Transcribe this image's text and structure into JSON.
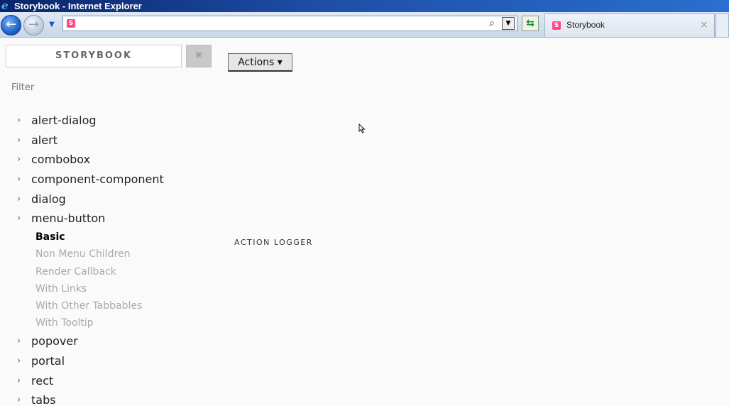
{
  "window": {
    "title": "Storybook - Internet Explorer"
  },
  "navbar": {
    "address_value": "",
    "favicon_letter": "S",
    "tab_label": "Storybook",
    "tab_close": "×"
  },
  "sidebar": {
    "brand": "STORYBOOK",
    "shortcut_icon": "⌘",
    "filter_placeholder": "Filter",
    "kinds": [
      {
        "label": "alert-dialog"
      },
      {
        "label": "alert"
      },
      {
        "label": "combobox"
      },
      {
        "label": "component-component"
      },
      {
        "label": "dialog"
      },
      {
        "label": "menu-button"
      }
    ],
    "stories": [
      {
        "label": "Basic",
        "active": true
      },
      {
        "label": "Non Menu Children",
        "active": false
      },
      {
        "label": "Render Callback",
        "active": false
      },
      {
        "label": "With Links",
        "active": false
      },
      {
        "label": "With Other Tabbables",
        "active": false
      },
      {
        "label": "With Tooltip",
        "active": false
      }
    ],
    "kinds_after": [
      {
        "label": "popover"
      },
      {
        "label": "portal"
      },
      {
        "label": "rect"
      },
      {
        "label": "tabs"
      }
    ]
  },
  "main": {
    "actions_label": "Actions ▾",
    "action_logger_label": "ACTION LOGGER"
  }
}
